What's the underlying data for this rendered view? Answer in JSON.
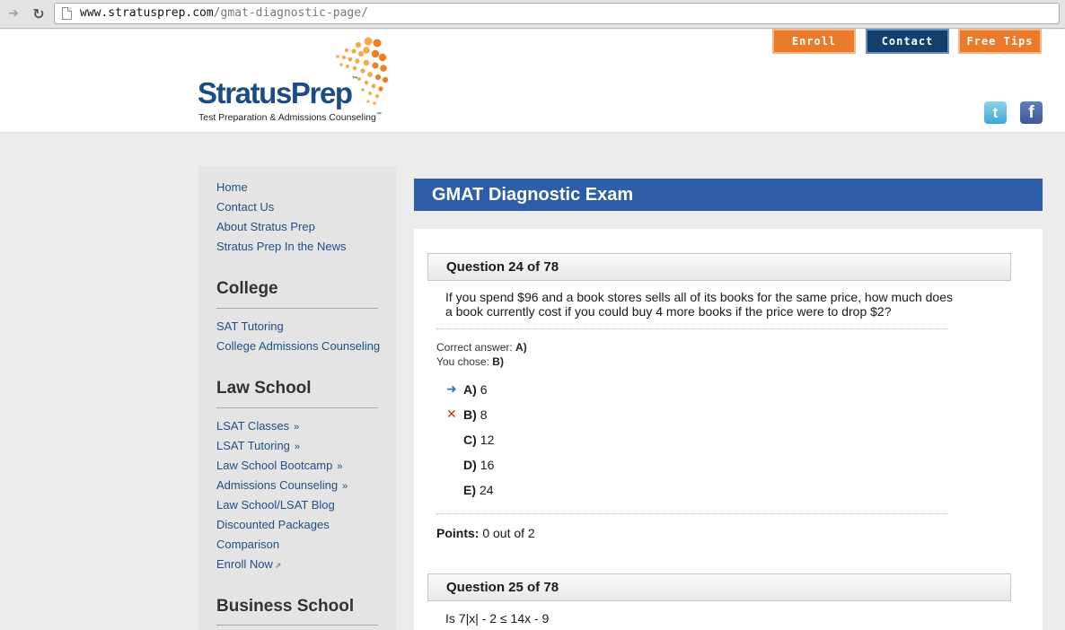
{
  "browser": {
    "url_host": "www.stratusprep.com",
    "url_path": "/gmat-diagnostic-page/"
  },
  "header": {
    "logo_word": "StratusPrep",
    "logo_tm": "™",
    "logo_tagline": "Test Preparation & Admissions Counseling",
    "buttons": {
      "enroll": "Enroll",
      "contact": "Contact",
      "free_tips": "Free Tips"
    },
    "social": {
      "twitter_glyph": "t",
      "facebook_glyph": "f"
    },
    "colors": {
      "brand_blue": "#1b4c86",
      "brand_orange": "#ec7a2b",
      "contact_navy": "#123f6d"
    }
  },
  "sidebar": {
    "top_links": [
      "Home",
      "Contact Us",
      "About Stratus Prep",
      "Stratus Prep In the News"
    ],
    "sections": [
      {
        "heading": "College",
        "links": [
          "SAT Tutoring",
          "College Admissions Counseling"
        ]
      },
      {
        "heading": "Law School",
        "links": [
          "LSAT Classes",
          "LSAT Tutoring",
          "Law School Bootcamp",
          "Admissions Counseling",
          "Law School/LSAT Blog",
          "Discounted Packages",
          "Comparison",
          "Enroll Now"
        ]
      },
      {
        "heading": "Business School"
      }
    ],
    "raquo": "»"
  },
  "main": {
    "title": "GMAT Diagnostic Exam",
    "title_color": "#2e5da9",
    "questions": [
      {
        "heading": "Question 24 of 78",
        "text_line1": "If you spend $96 and a book stores sells all of its books for the same price, how much does",
        "text_line2": "a book currently cost if you could buy 4 more books if the price were to drop $2?",
        "correct_label": "Correct answer:",
        "correct_value": "A)",
        "chose_label": "You chose:",
        "chose_value": "B)",
        "options": [
          {
            "letter": "A)",
            "value": "6"
          },
          {
            "letter": "B)",
            "value": "8"
          },
          {
            "letter": "C)",
            "value": "12"
          },
          {
            "letter": "D)",
            "value": "16"
          },
          {
            "letter": "E)",
            "value": "24"
          }
        ],
        "points_label": "Points:",
        "points_value": "0 out of 2"
      },
      {
        "heading": "Question 25 of 78",
        "text_line1": "Is 7|x| - 2 ≤ 14x - 9"
      }
    ]
  }
}
